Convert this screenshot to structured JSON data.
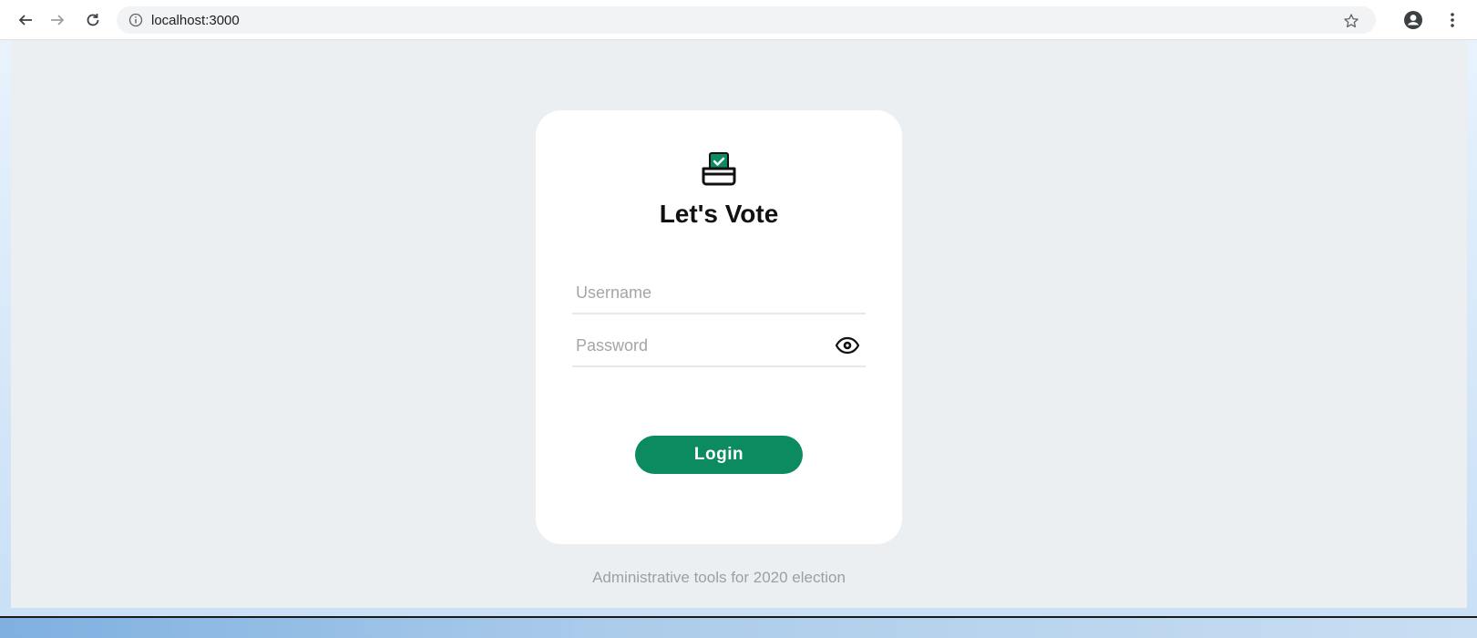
{
  "browser": {
    "url": "localhost:3000",
    "icons": {
      "back": "arrow-left-icon",
      "forward": "arrow-right-icon",
      "reload": "reload-icon",
      "info": "info-icon",
      "bookmark": "star-icon",
      "profile": "account-circle-icon",
      "menu": "more-vert-icon"
    }
  },
  "login": {
    "logo_icon": "ballot-box-icon",
    "title": "Let's Vote",
    "username_placeholder": "Username",
    "password_placeholder": "Password",
    "password_toggle_icon": "eye-icon",
    "login_label": "Login"
  },
  "footer": {
    "text": "Administrative tools for 2020 election"
  },
  "colors": {
    "accent": "#0b8b5f",
    "page_background": "#eceff1",
    "card_background": "#ffffff"
  }
}
